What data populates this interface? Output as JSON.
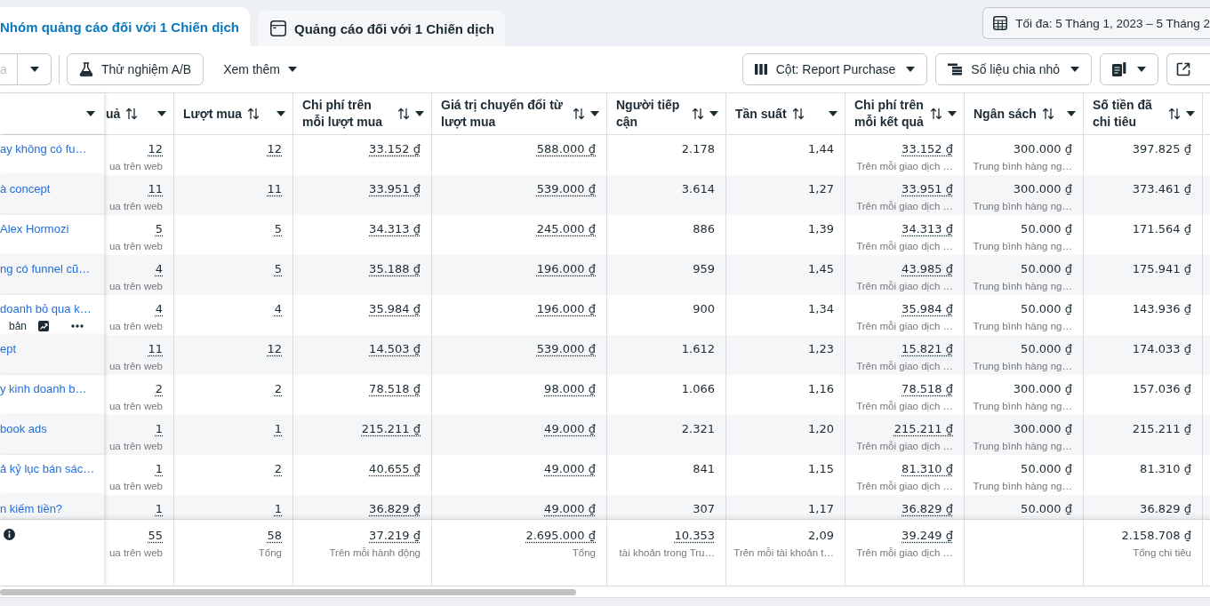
{
  "tabs": [
    {
      "label": "Nhóm quảng cáo đối với 1 Chiến dịch",
      "kind": "ad_set",
      "selected": true
    },
    {
      "label": "Quảng cáo đối với 1 Chiến dịch",
      "kind": "ad",
      "selected": false
    }
  ],
  "date_range": {
    "label": "Tối đa: 5 Tháng 1, 2023 – 5 Tháng 2"
  },
  "toolbar": {
    "left": [
      {
        "kind": "split",
        "label": "a",
        "disabled": true
      },
      {
        "kind": "button",
        "label": "Thử nghiệm A/B",
        "disabled": false
      },
      {
        "kind": "text_menu",
        "label": "Xem thêm",
        "disabled": false
      }
    ],
    "right": [
      {
        "kind": "menu",
        "label": "Cột: Report Purchase"
      },
      {
        "kind": "menu",
        "label": "Số liệu chia nhỏ"
      },
      {
        "kind": "icon_menu"
      },
      {
        "kind": "icon"
      }
    ]
  },
  "table": {
    "columns": [
      {
        "label": "uả",
        "sortable": true,
        "underlined": true
      },
      {
        "label": "Lượt mua",
        "sortable": true,
        "underlined": true
      },
      {
        "label": "Chi phí trên mỗi lượt mua",
        "sortable": true,
        "underlined": true
      },
      {
        "label": "Giá trị chuyển đổi từ lượt mua",
        "sortable": true,
        "underlined": true
      },
      {
        "label": "Người tiếp cận",
        "sortable": true,
        "underlined": false
      },
      {
        "label": "Tần suất",
        "sortable": true,
        "underlined": false
      },
      {
        "label": "Chi phí trên mỗi kết quả",
        "sortable": true,
        "underlined": true
      },
      {
        "label": "Ngân sách",
        "sortable": true,
        "underlined": false
      },
      {
        "label": "Số tiền đã chi tiêu",
        "sortable": true,
        "underlined": false
      }
    ],
    "rows": [
      {
        "name": "ay không có fu…",
        "cells": [
          {
            "value": "12",
            "note": "ua trên web"
          },
          {
            "value": "12"
          },
          {
            "value": "33.152 ₫"
          },
          {
            "value": "588.000 ₫"
          },
          {
            "value": "2.178"
          },
          {
            "value": "1,44"
          },
          {
            "value": "33.152 ₫",
            "note": "Trên mỗi giao dịch …"
          },
          {
            "value": "300.000 ₫",
            "note": "Trung bình hàng ng…"
          },
          {
            "value": "397.825 ₫"
          }
        ]
      },
      {
        "name": "à concept",
        "cells": [
          {
            "value": "11",
            "note": "ua trên web"
          },
          {
            "value": "11"
          },
          {
            "value": "33.951 ₫"
          },
          {
            "value": "539.000 ₫"
          },
          {
            "value": "3.614"
          },
          {
            "value": "1,27"
          },
          {
            "value": "33.951 ₫",
            "note": "Trên mỗi giao dịch …"
          },
          {
            "value": "300.000 ₫",
            "note": "Trung bình hàng ng…"
          },
          {
            "value": "373.461 ₫"
          }
        ]
      },
      {
        "name": "Alex Hormozi",
        "cells": [
          {
            "value": "5",
            "note": "ua trên web"
          },
          {
            "value": "5"
          },
          {
            "value": "34.313 ₫"
          },
          {
            "value": "245.000 ₫"
          },
          {
            "value": "886"
          },
          {
            "value": "1,39"
          },
          {
            "value": "34.313 ₫",
            "note": "Trên mỗi giao dịch …"
          },
          {
            "value": "50.000 ₫",
            "note": "Trung bình hàng ng…"
          },
          {
            "value": "171.564 ₫"
          }
        ]
      },
      {
        "name": "ng có funnel cũ…",
        "cells": [
          {
            "value": "4",
            "note": "ua trên web"
          },
          {
            "value": "5"
          },
          {
            "value": "35.188 ₫"
          },
          {
            "value": "196.000 ₫"
          },
          {
            "value": "959"
          },
          {
            "value": "1,45"
          },
          {
            "value": "43.985 ₫",
            "note": "Trên mỗi giao dịch …"
          },
          {
            "value": "50.000 ₫",
            "note": "Trung bình hàng ng…"
          },
          {
            "value": "175.941 ₫"
          }
        ]
      },
      {
        "name": "doanh bỏ qua k…",
        "actions": {
          "label": "bản"
        },
        "cells": [
          {
            "value": "4",
            "note": "ua trên web"
          },
          {
            "value": "4"
          },
          {
            "value": "35.984 ₫"
          },
          {
            "value": "196.000 ₫"
          },
          {
            "value": "900"
          },
          {
            "value": "1,34"
          },
          {
            "value": "35.984 ₫",
            "note": "Trên mỗi giao dịch …"
          },
          {
            "value": "50.000 ₫",
            "note": "Trung bình hàng ng…"
          },
          {
            "value": "143.936 ₫"
          }
        ]
      },
      {
        "name": "ept",
        "cells": [
          {
            "value": "11",
            "note": "ua trên web"
          },
          {
            "value": "12"
          },
          {
            "value": "14.503 ₫"
          },
          {
            "value": "539.000 ₫"
          },
          {
            "value": "1.612"
          },
          {
            "value": "1,23"
          },
          {
            "value": "15.821 ₫",
            "note": "Trên mỗi giao dịch …"
          },
          {
            "value": "50.000 ₫",
            "note": "Trung bình hàng ng…"
          },
          {
            "value": "174.033 ₫"
          }
        ]
      },
      {
        "name": "y kinh doanh b…",
        "cells": [
          {
            "value": "2",
            "note": "ua trên web"
          },
          {
            "value": "2"
          },
          {
            "value": "78.518 ₫"
          },
          {
            "value": "98.000 ₫"
          },
          {
            "value": "1.066"
          },
          {
            "value": "1,16"
          },
          {
            "value": "78.518 ₫",
            "note": "Trên mỗi giao dịch …"
          },
          {
            "value": "300.000 ₫",
            "note": "Trung bình hàng ng…"
          },
          {
            "value": "157.036 ₫"
          }
        ]
      },
      {
        "name": "book ads",
        "cells": [
          {
            "value": "1",
            "note": "ua trên web"
          },
          {
            "value": "1"
          },
          {
            "value": "215.211 ₫"
          },
          {
            "value": "49.000 ₫"
          },
          {
            "value": "2.321"
          },
          {
            "value": "1,20"
          },
          {
            "value": "215.211 ₫",
            "note": "Trên mỗi giao dịch …"
          },
          {
            "value": "300.000 ₫",
            "note": "Trung bình hàng ng…"
          },
          {
            "value": "215.211 ₫"
          }
        ]
      },
      {
        "name": "ả kỷ lục bán sác…",
        "cells": [
          {
            "value": "1",
            "note": "ua trên web"
          },
          {
            "value": "2"
          },
          {
            "value": "40.655 ₫"
          },
          {
            "value": "49.000 ₫"
          },
          {
            "value": "841"
          },
          {
            "value": "1,15"
          },
          {
            "value": "81.310 ₫",
            "note": "Trên mỗi giao dịch …"
          },
          {
            "value": "50.000 ₫",
            "note": "Trung bình hàng ng…"
          },
          {
            "value": "81.310 ₫"
          }
        ]
      },
      {
        "name": "n kiếm tiền?",
        "cells": [
          {
            "value": "1"
          },
          {
            "value": "1"
          },
          {
            "value": "36.829 ₫"
          },
          {
            "value": "49.000 ₫"
          },
          {
            "value": "307"
          },
          {
            "value": "1,17"
          },
          {
            "value": "36.829 ₫"
          },
          {
            "value": "50.000 ₫"
          },
          {
            "value": "36.829 ₫"
          }
        ]
      }
    ],
    "totals": [
      {
        "kind": "value",
        "value": "55",
        "note": "ua trên web",
        "underlined": true
      },
      {
        "kind": "value",
        "value": "58",
        "note": "Tổng",
        "underlined": true
      },
      {
        "kind": "value",
        "value": "37.219 ₫",
        "note": "Trên mỗi hành động",
        "underlined": true
      },
      {
        "kind": "value",
        "value": "2.695.000 ₫",
        "note": "Tổng",
        "underlined": true
      },
      {
        "kind": "value",
        "value": "10.353",
        "note": "tài khoản trong Tru…",
        "underlined": true
      },
      {
        "kind": "value",
        "value": "2,09",
        "note": "Trên mỗi tài khoản t…",
        "underlined": false
      },
      {
        "kind": "value",
        "value": "39.249 ₫",
        "note": "Trên mỗi giao dịch …",
        "underlined": true
      },
      {
        "kind": "blank"
      },
      {
        "kind": "value",
        "value": "2.158.708 ₫",
        "note": "Tổng chi tiêu",
        "underlined": false
      }
    ]
  }
}
